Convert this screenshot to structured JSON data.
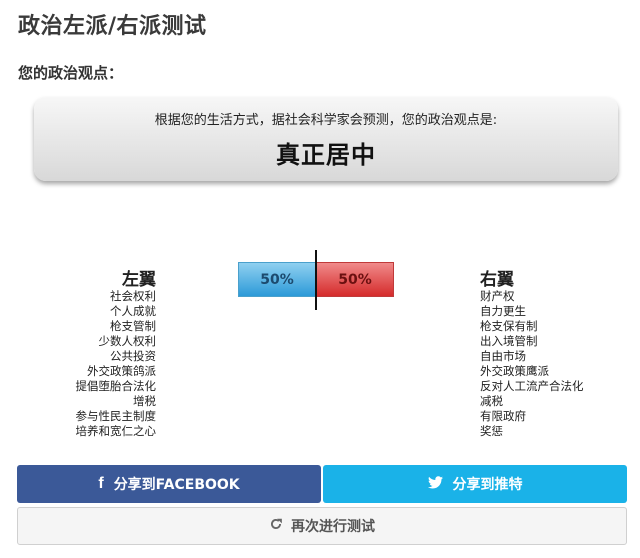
{
  "page": {
    "title": "政治左派/右派测试",
    "subtitle": "您的政治观点："
  },
  "result": {
    "intro": "根据您的生活方式，据社会科学家会预测，您的政治观点是:",
    "value": "真正居中"
  },
  "meter": {
    "left_percent": 50,
    "right_percent": 50,
    "left_label": "50%",
    "right_label": "50%",
    "left_color": "#2c9ad8",
    "right_color": "#d52b2b"
  },
  "left": {
    "heading": "左翼",
    "items": [
      "社会权利",
      "个人成就",
      "枪支管制",
      "少数人权利",
      "公共投资",
      "外交政策鸽派",
      "提倡堕胎合法化",
      "增税",
      "参与性民主制度",
      "培养和宽仁之心"
    ]
  },
  "right": {
    "heading": "右翼",
    "items": [
      "财产权",
      "自力更生",
      "枪支保有制",
      "出入境管制",
      "自由市场",
      "外交政策鹰派",
      "反对人工流产合法化",
      "减税",
      "有限政府",
      "奖惩"
    ]
  },
  "buttons": {
    "facebook": {
      "label": "分享到FACEBOOK",
      "icon": "facebook-icon",
      "color": "#3b5998"
    },
    "twitter": {
      "label": "分享到推特",
      "icon": "twitter-bird-icon",
      "color": "#1ab2e8"
    },
    "retake": {
      "label": "再次进行测试",
      "icon": "refresh-icon"
    }
  }
}
